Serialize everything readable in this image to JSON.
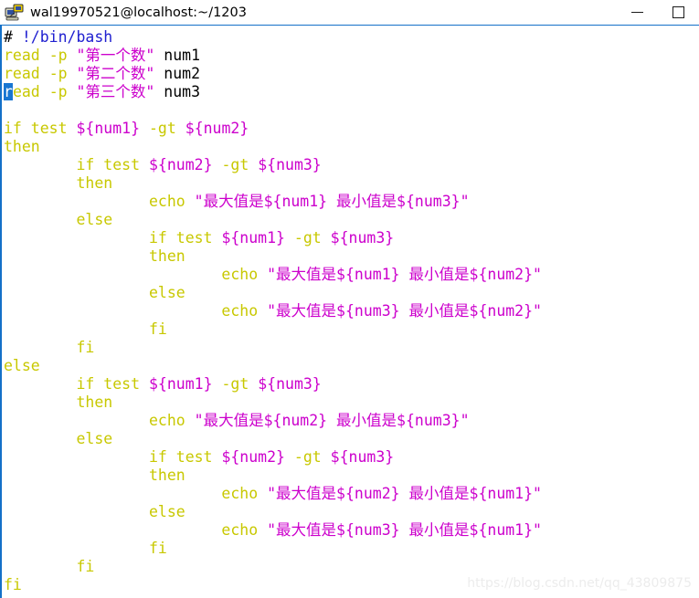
{
  "window": {
    "title": "wal19970521@localhost:~/1203",
    "icon": "putty-terminal-icon",
    "controls": {
      "minimize_label": "—",
      "maximize_label": "□"
    }
  },
  "theme": {
    "background": "#ffffff",
    "border": "#1470c8",
    "comment_color": "#2020d0",
    "keyword_color": "#c8c800",
    "string_color": "#cc00cc",
    "variable_color": "#cc00cc",
    "plain_color": "#000000",
    "cursor_bg": "#1876d2",
    "cursor_fg": "#ffffff",
    "watermark_color": "#ececec"
  },
  "watermark": {
    "text": "https://blog.csdn.net/qq_43809875"
  },
  "editor": {
    "filename_hint": "",
    "cursor": {
      "line": 4,
      "column": 1,
      "char": "r"
    },
    "lines": [
      {
        "n": 1,
        "indent": 0,
        "tokens": [
          {
            "t": "# ",
            "c": "plain"
          },
          {
            "t": "!/bin/bash",
            "c": "comment"
          }
        ]
      },
      {
        "n": 2,
        "indent": 0,
        "tokens": [
          {
            "t": "read",
            "c": "keyword"
          },
          {
            "t": " ",
            "c": "plain"
          },
          {
            "t": "-p",
            "c": "keyword"
          },
          {
            "t": " ",
            "c": "plain"
          },
          {
            "t": "\"第一个数\"",
            "c": "string"
          },
          {
            "t": " num1",
            "c": "plain"
          }
        ]
      },
      {
        "n": 3,
        "indent": 0,
        "tokens": [
          {
            "t": "read",
            "c": "keyword"
          },
          {
            "t": " ",
            "c": "plain"
          },
          {
            "t": "-p",
            "c": "keyword"
          },
          {
            "t": " ",
            "c": "plain"
          },
          {
            "t": "\"第二个数\"",
            "c": "string"
          },
          {
            "t": " num2",
            "c": "plain"
          }
        ]
      },
      {
        "n": 4,
        "indent": 0,
        "tokens": [
          {
            "t": "r",
            "c": "cursor"
          },
          {
            "t": "ead",
            "c": "keyword"
          },
          {
            "t": " ",
            "c": "plain"
          },
          {
            "t": "-p",
            "c": "keyword"
          },
          {
            "t": " ",
            "c": "plain"
          },
          {
            "t": "\"第三个数\"",
            "c": "string"
          },
          {
            "t": " num3",
            "c": "plain"
          }
        ]
      },
      {
        "n": 5,
        "indent": 0,
        "tokens": []
      },
      {
        "n": 6,
        "indent": 0,
        "tokens": [
          {
            "t": "if test ",
            "c": "keyword"
          },
          {
            "t": "${num1}",
            "c": "variable"
          },
          {
            "t": " ",
            "c": "plain"
          },
          {
            "t": "-gt",
            "c": "keyword"
          },
          {
            "t": " ",
            "c": "plain"
          },
          {
            "t": "${num2}",
            "c": "variable"
          }
        ]
      },
      {
        "n": 7,
        "indent": 0,
        "tokens": [
          {
            "t": "then",
            "c": "keyword"
          }
        ]
      },
      {
        "n": 8,
        "indent": 8,
        "tokens": [
          {
            "t": "if test ",
            "c": "keyword"
          },
          {
            "t": "${num2}",
            "c": "variable"
          },
          {
            "t": " ",
            "c": "plain"
          },
          {
            "t": "-gt",
            "c": "keyword"
          },
          {
            "t": " ",
            "c": "plain"
          },
          {
            "t": "${num3}",
            "c": "variable"
          }
        ]
      },
      {
        "n": 9,
        "indent": 8,
        "tokens": [
          {
            "t": "then",
            "c": "keyword"
          }
        ]
      },
      {
        "n": 10,
        "indent": 16,
        "tokens": [
          {
            "t": "echo",
            "c": "keyword"
          },
          {
            "t": " ",
            "c": "plain"
          },
          {
            "t": "\"最大值是${num1} 最小值是${num3}\"",
            "c": "string"
          }
        ]
      },
      {
        "n": 11,
        "indent": 8,
        "tokens": [
          {
            "t": "else",
            "c": "keyword"
          }
        ]
      },
      {
        "n": 12,
        "indent": 16,
        "tokens": [
          {
            "t": "if test ",
            "c": "keyword"
          },
          {
            "t": "${num1}",
            "c": "variable"
          },
          {
            "t": " ",
            "c": "plain"
          },
          {
            "t": "-gt",
            "c": "keyword"
          },
          {
            "t": " ",
            "c": "plain"
          },
          {
            "t": "${num3}",
            "c": "variable"
          }
        ]
      },
      {
        "n": 13,
        "indent": 16,
        "tokens": [
          {
            "t": "then",
            "c": "keyword"
          }
        ]
      },
      {
        "n": 14,
        "indent": 24,
        "tokens": [
          {
            "t": "echo",
            "c": "keyword"
          },
          {
            "t": " ",
            "c": "plain"
          },
          {
            "t": "\"最大值是${num1} 最小值是${num2}\"",
            "c": "string"
          }
        ]
      },
      {
        "n": 15,
        "indent": 16,
        "tokens": [
          {
            "t": "else",
            "c": "keyword"
          }
        ]
      },
      {
        "n": 16,
        "indent": 24,
        "tokens": [
          {
            "t": "echo",
            "c": "keyword"
          },
          {
            "t": " ",
            "c": "plain"
          },
          {
            "t": "\"最大值是${num3} 最小值是${num2}\"",
            "c": "string"
          }
        ]
      },
      {
        "n": 17,
        "indent": 16,
        "tokens": [
          {
            "t": "fi",
            "c": "keyword"
          }
        ]
      },
      {
        "n": 18,
        "indent": 8,
        "tokens": [
          {
            "t": "fi",
            "c": "keyword"
          }
        ]
      },
      {
        "n": 19,
        "indent": 0,
        "tokens": [
          {
            "t": "else",
            "c": "keyword"
          }
        ]
      },
      {
        "n": 20,
        "indent": 8,
        "tokens": [
          {
            "t": "if test ",
            "c": "keyword"
          },
          {
            "t": "${num1}",
            "c": "variable"
          },
          {
            "t": " ",
            "c": "plain"
          },
          {
            "t": "-gt",
            "c": "keyword"
          },
          {
            "t": " ",
            "c": "plain"
          },
          {
            "t": "${num3}",
            "c": "variable"
          }
        ]
      },
      {
        "n": 21,
        "indent": 8,
        "tokens": [
          {
            "t": "then",
            "c": "keyword"
          }
        ]
      },
      {
        "n": 22,
        "indent": 16,
        "tokens": [
          {
            "t": "echo",
            "c": "keyword"
          },
          {
            "t": " ",
            "c": "plain"
          },
          {
            "t": "\"最大值是${num2} 最小值是${num3}\"",
            "c": "string"
          }
        ]
      },
      {
        "n": 23,
        "indent": 8,
        "tokens": [
          {
            "t": "else",
            "c": "keyword"
          }
        ]
      },
      {
        "n": 24,
        "indent": 16,
        "tokens": [
          {
            "t": "if test ",
            "c": "keyword"
          },
          {
            "t": "${num2}",
            "c": "variable"
          },
          {
            "t": " ",
            "c": "plain"
          },
          {
            "t": "-gt",
            "c": "keyword"
          },
          {
            "t": " ",
            "c": "plain"
          },
          {
            "t": "${num3}",
            "c": "variable"
          }
        ]
      },
      {
        "n": 25,
        "indent": 16,
        "tokens": [
          {
            "t": "then",
            "c": "keyword"
          }
        ]
      },
      {
        "n": 26,
        "indent": 24,
        "tokens": [
          {
            "t": "echo",
            "c": "keyword"
          },
          {
            "t": " ",
            "c": "plain"
          },
          {
            "t": "\"最大值是${num2} 最小值是${num1}\"",
            "c": "string"
          }
        ]
      },
      {
        "n": 27,
        "indent": 16,
        "tokens": [
          {
            "t": "else",
            "c": "keyword"
          }
        ]
      },
      {
        "n": 28,
        "indent": 24,
        "tokens": [
          {
            "t": "echo",
            "c": "keyword"
          },
          {
            "t": " ",
            "c": "plain"
          },
          {
            "t": "\"最大值是${num3} 最小值是${num1}\"",
            "c": "string"
          }
        ]
      },
      {
        "n": 29,
        "indent": 16,
        "tokens": [
          {
            "t": "fi",
            "c": "keyword"
          }
        ]
      },
      {
        "n": 30,
        "indent": 8,
        "tokens": [
          {
            "t": "fi",
            "c": "keyword"
          }
        ]
      },
      {
        "n": 31,
        "indent": 0,
        "tokens": [
          {
            "t": "fi",
            "c": "keyword"
          }
        ]
      }
    ]
  }
}
